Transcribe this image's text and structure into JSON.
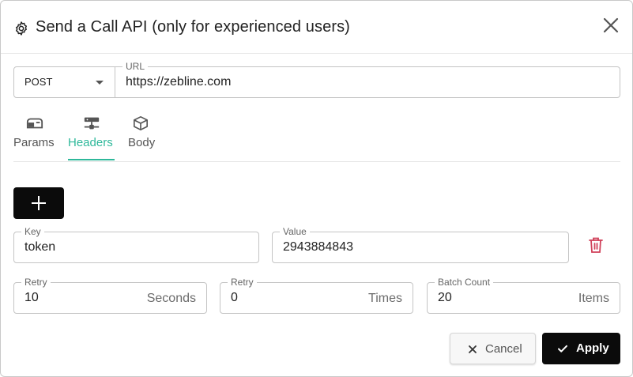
{
  "dialog": {
    "title": "Send a Call API (only for experienced users)",
    "icons": {
      "title": "gear-icon",
      "close": "close-icon"
    }
  },
  "request": {
    "method": "POST",
    "url_label": "URL",
    "url": "https://zebline.com"
  },
  "tabs": [
    {
      "label": "Params",
      "icon": "mailbox-icon",
      "active": false
    },
    {
      "label": "Headers",
      "icon": "server-icon",
      "active": true
    },
    {
      "label": "Body",
      "icon": "cube-icon",
      "active": false
    }
  ],
  "headers": {
    "add_icon": "plus-icon",
    "key_label": "Key",
    "key": "token",
    "value_label": "Value",
    "value": "2943884843",
    "delete_icon": "trash-icon"
  },
  "settings": {
    "retry_seconds": {
      "label": "Retry",
      "value": "10",
      "unit": "Seconds"
    },
    "retry_times": {
      "label": "Retry",
      "value": "0",
      "unit": "Times"
    },
    "batch_count": {
      "label": "Batch Count",
      "value": "20",
      "unit": "Items"
    }
  },
  "actions": {
    "cancel": "Cancel",
    "apply": "Apply"
  },
  "colors": {
    "accent": "#2eb89a",
    "primary_button": "#0b0b0b",
    "danger": "#d0415a"
  }
}
